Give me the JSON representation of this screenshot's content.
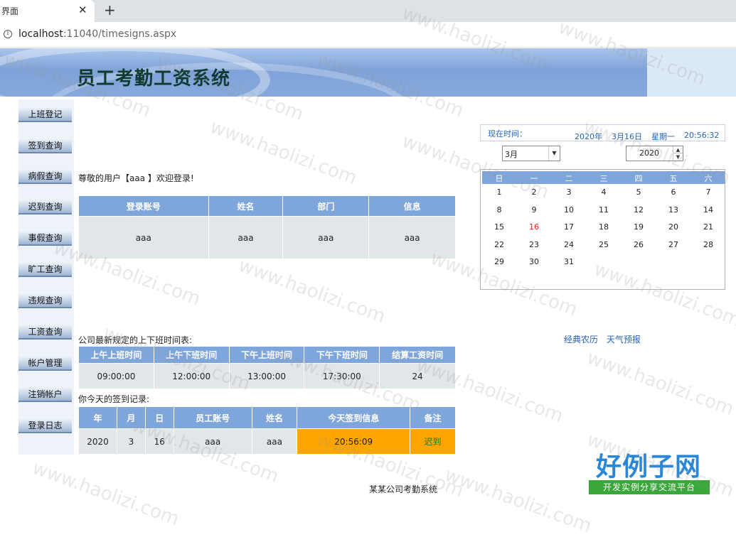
{
  "browser": {
    "tab_title": "界面",
    "tab_close": "✕",
    "new_tab": "+",
    "url_host": "localhost",
    "url_rest": ":11040/timesigns.aspx"
  },
  "banner": {
    "title": "员工考勤工资系统"
  },
  "sidebar": {
    "items": [
      {
        "label": "上班登记"
      },
      {
        "label": "签到查询"
      },
      {
        "label": "病假查询"
      },
      {
        "label": "迟到查询"
      },
      {
        "label": "事假查询"
      },
      {
        "label": "旷工查询"
      },
      {
        "label": "违规查询"
      },
      {
        "label": "工资查询"
      },
      {
        "label": "帐户管理"
      },
      {
        "label": "注销帐户"
      },
      {
        "label": "登录日志"
      }
    ]
  },
  "welcome": {
    "text": "尊敬的用户【aaa 】欢迎登录!"
  },
  "user_table": {
    "headers": [
      "登录账号",
      "姓名",
      "部门",
      "信息"
    ],
    "row": [
      "aaa",
      "aaa",
      "aaa",
      "aaa"
    ]
  },
  "schedule": {
    "caption": "公司最新规定的上下班时间表:",
    "headers": [
      "上午上班时间",
      "上午下班时间",
      "下午上班时间",
      "下午下班时间",
      "结算工资时间"
    ],
    "row": [
      "09:00:00",
      "12:00:00",
      "13:00:00",
      "17:30:00",
      "24"
    ]
  },
  "signin": {
    "caption": "你今天的签到记录:",
    "headers": [
      "年",
      "月",
      "日",
      "员工账号",
      "姓名",
      "今天签到信息",
      "备注"
    ],
    "row": [
      "2020",
      "3",
      "16",
      "aaa",
      "aaa",
      "20:56:09",
      "迟到"
    ]
  },
  "clock": {
    "label": "现在时间：",
    "year": "2020年",
    "date": "3月16日",
    "weekday": "星期一",
    "time": "20:56:32"
  },
  "calendar": {
    "month_select": "3月",
    "year": "2020",
    "weekdays": [
      "日",
      "一",
      "二",
      "三",
      "四",
      "五",
      "六"
    ],
    "today": "16",
    "weeks": [
      [
        "1",
        "2",
        "3",
        "4",
        "5",
        "6",
        "7"
      ],
      [
        "8",
        "9",
        "10",
        "11",
        "12",
        "13",
        "14"
      ],
      [
        "15",
        "16",
        "17",
        "18",
        "19",
        "20",
        "21"
      ],
      [
        "22",
        "23",
        "24",
        "25",
        "26",
        "27",
        "28"
      ],
      [
        "29",
        "30",
        "31",
        "",
        "",
        "",
        ""
      ]
    ]
  },
  "links": {
    "lunar": "经典农历",
    "weather": "天气预报"
  },
  "footer": {
    "text": "某某公司考勤系统"
  },
  "logo": {
    "main": "好例子网",
    "sub": "开发实例分享交流平台"
  },
  "watermark": {
    "text": "www.haolizi.com"
  },
  "colors": {
    "accent": "#7fa6db",
    "late": "#ffa500",
    "today": "#e0241b",
    "link": "#2563b8"
  }
}
